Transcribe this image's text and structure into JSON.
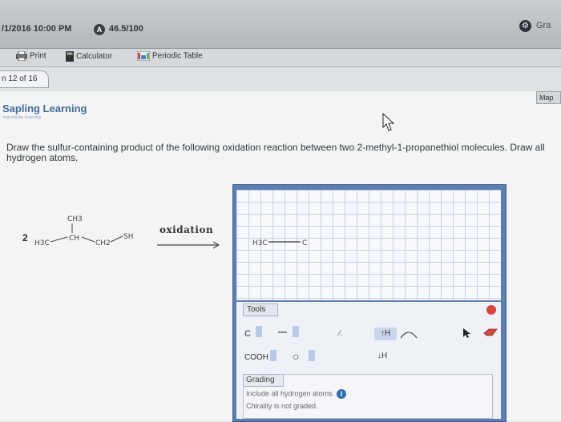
{
  "header": {
    "date_time": "/1/2016 10:00 PM",
    "score_badge": "A",
    "score": "46.5/100",
    "grade_label": "Gra"
  },
  "toolbar": {
    "print_label": "Print",
    "calculator_label": "Calculator",
    "periodic_table_label": "Periodic Table"
  },
  "question_tab": {
    "label": "n 12 of 16"
  },
  "map_button": {
    "label": "Map"
  },
  "brand": {
    "name": "Sapling Learning",
    "subtitle": "macmillan learning"
  },
  "question": {
    "text": "Draw the sulfur-containing product of the following oxidation reaction between two 2-methyl-1-propanethiol molecules. Draw all hydrogen atoms."
  },
  "reaction": {
    "coefficient": "2",
    "arrow_label": "oxidation",
    "molecule_labels": {
      "ch3_top": "CH3",
      "h3c": "H3C",
      "ch": "CH",
      "ch2": "CH2",
      "sh": "SH"
    }
  },
  "editor": {
    "canvas_molecule": {
      "left": "H3C",
      "right": "C"
    },
    "tools": {
      "label": "Tools",
      "carbon": "C",
      "bond": "—",
      "cooh": "COOH",
      "ring": "○",
      "add_h": "↑H",
      "remove_h": "↓H",
      "percent": "⁄."
    },
    "grading": {
      "label": "Grading",
      "hint_1": "Include all hydrogen atoms.",
      "hint_2": "Chirality is not graded."
    }
  },
  "colors": {
    "brand": "#3d6e9e",
    "editor_frame": "#5b7fb5",
    "clear_icon": "#d9473b",
    "info_icon": "#2e6fb5"
  }
}
